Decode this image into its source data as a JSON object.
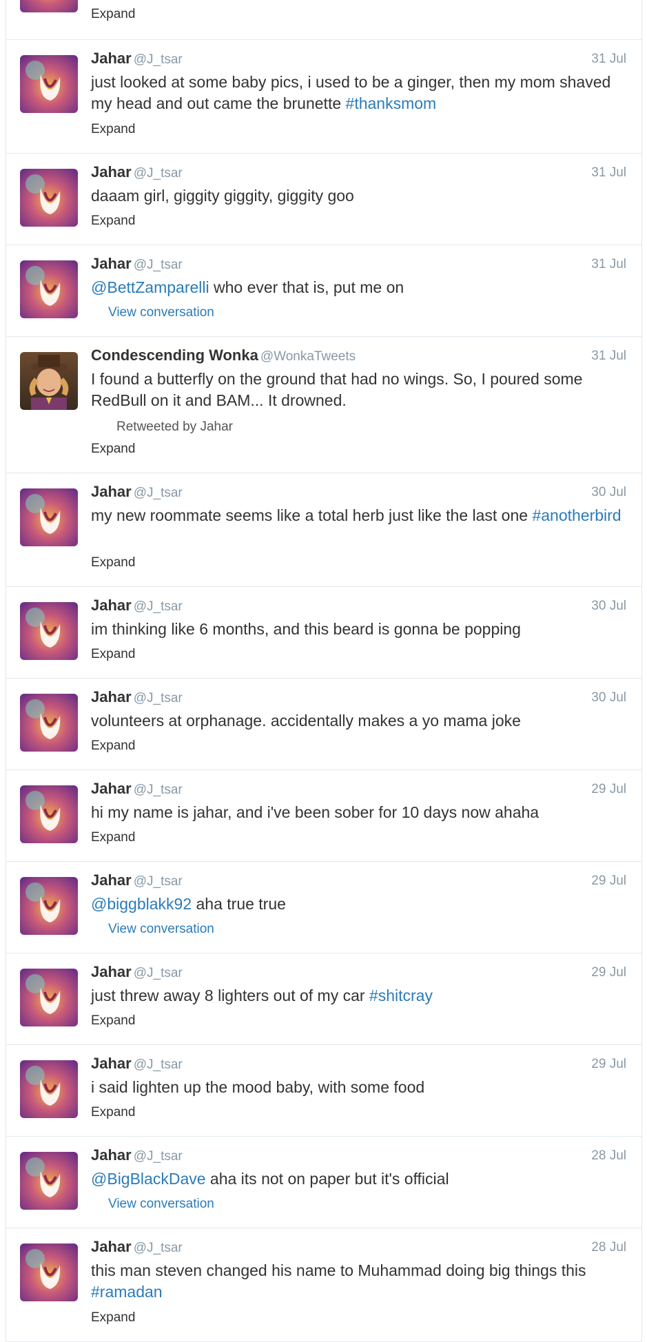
{
  "top": {
    "expand_label": "Expand"
  },
  "labels": {
    "expand": "Expand",
    "view_conversation": "View conversation",
    "retweeted_by": "Retweeted by Jahar"
  },
  "tweets": [
    {
      "name": "Jahar",
      "handle": "@J_tsar",
      "date": "31 Jul",
      "text_parts": [
        "just looked at some baby pics, i used to be a ginger, then my mom shaved my head and out came the brunette ",
        "#thanksmom"
      ],
      "action": "Expand"
    },
    {
      "name": "Jahar",
      "handle": "@J_tsar",
      "date": "31 Jul",
      "text_parts": [
        "daaam girl, giggity giggity, giggity goo"
      ],
      "action": "Expand"
    },
    {
      "name": "Jahar",
      "handle": "@J_tsar",
      "date": "31 Jul",
      "text_parts": [
        "@BettZamparelli",
        " who ever that is, put me on"
      ],
      "action": "View conversation"
    },
    {
      "name": "Condescending Wonka",
      "handle": "@WonkaTweets",
      "date": "31 Jul",
      "text_parts": [
        "I found a butterfly on the ground that had no wings. So, I poured some RedBull on it and BAM... It drowned."
      ],
      "retweeted": "Retweeted by Jahar",
      "action": "Expand"
    },
    {
      "name": "Jahar",
      "handle": "@J_tsar",
      "date": "30 Jul",
      "text_parts": [
        "my new roommate seems like a total herb just like the last one ",
        "#anotherbird"
      ],
      "action": "Expand"
    },
    {
      "name": "Jahar",
      "handle": "@J_tsar",
      "date": "30 Jul",
      "text_parts": [
        "im thinking like 6 months, and this beard is gonna be popping"
      ],
      "action": "Expand"
    },
    {
      "name": "Jahar",
      "handle": "@J_tsar",
      "date": "30 Jul",
      "text_parts": [
        "volunteers at orphanage. accidentally makes a yo mama joke"
      ],
      "action": "Expand"
    },
    {
      "name": "Jahar",
      "handle": "@J_tsar",
      "date": "29 Jul",
      "text_parts": [
        "hi my name is jahar, and i've been sober for 10 days now ahaha"
      ],
      "action": "Expand"
    },
    {
      "name": "Jahar",
      "handle": "@J_tsar",
      "date": "29 Jul",
      "text_parts": [
        "@biggblakk92",
        " aha true true"
      ],
      "action": "View conversation"
    },
    {
      "name": "Jahar",
      "handle": "@J_tsar",
      "date": "29 Jul",
      "text_parts": [
        "just threw away 8 lighters out of my car ",
        "#shitcray"
      ],
      "action": "Expand"
    },
    {
      "name": "Jahar",
      "handle": "@J_tsar",
      "date": "29 Jul",
      "text_parts": [
        "i said lighten up the mood baby, with some food"
      ],
      "action": "Expand"
    },
    {
      "name": "Jahar",
      "handle": "@J_tsar",
      "date": "28 Jul",
      "text_parts": [
        "@BigBlackDave",
        " aha its not on paper but it's official"
      ],
      "action": "View conversation"
    },
    {
      "name": "Jahar",
      "handle": "@J_tsar",
      "date": "28 Jul",
      "text_parts": [
        "this man steven changed his name to Muhammad doing big things this ",
        "#ramadan"
      ],
      "action": "Expand"
    }
  ],
  "colors": {
    "link": "#2b7bb9",
    "meta": "#8899a6",
    "border": "#e1e8ed"
  }
}
